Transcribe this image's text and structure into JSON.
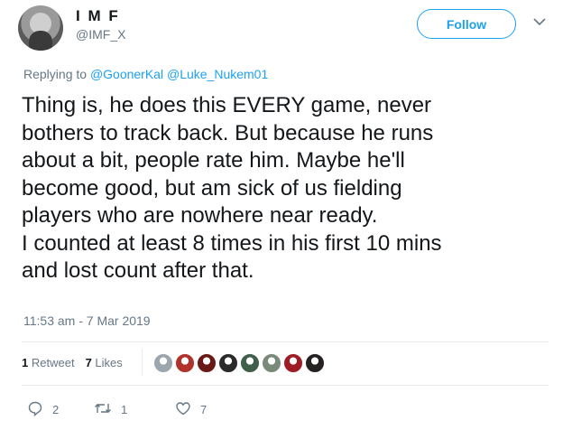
{
  "author": {
    "display_name": "I M F",
    "handle": "@IMF_X"
  },
  "follow_label": "Follow",
  "reply_to": {
    "prefix": "Replying to",
    "mention_1": "@GoonerKal",
    "mention_2": "@Luke_Nukem01"
  },
  "tweet_text": "Thing is, he does this EVERY game, never\nbothers to track back. But because he runs\nabout a bit, people rate him. Maybe he'll\nbecome good, but am sick of us fielding\nplayers who are nowhere near ready.\nI counted at least 8 times in his first 10 mins\nand lost count after that.",
  "timestamp": "11:53 am - 7 Mar 2019",
  "stats": {
    "retweet_count": "1",
    "retweet_label": "Retweet",
    "like_count": "7",
    "like_label": "Likes"
  },
  "liker_avatar_colors": [
    "#9ba6ae",
    "#b0322a",
    "#6a1a14",
    "#2b2b2b",
    "#3f5f4a",
    "#7a8a7a",
    "#a01c24",
    "#262222"
  ],
  "actions": {
    "reply_count": "2",
    "retweet_count": "1",
    "like_count": "7"
  },
  "colors": {
    "accent": "#1da1f2",
    "secondary_text": "#657786",
    "primary_text": "#14171a"
  }
}
